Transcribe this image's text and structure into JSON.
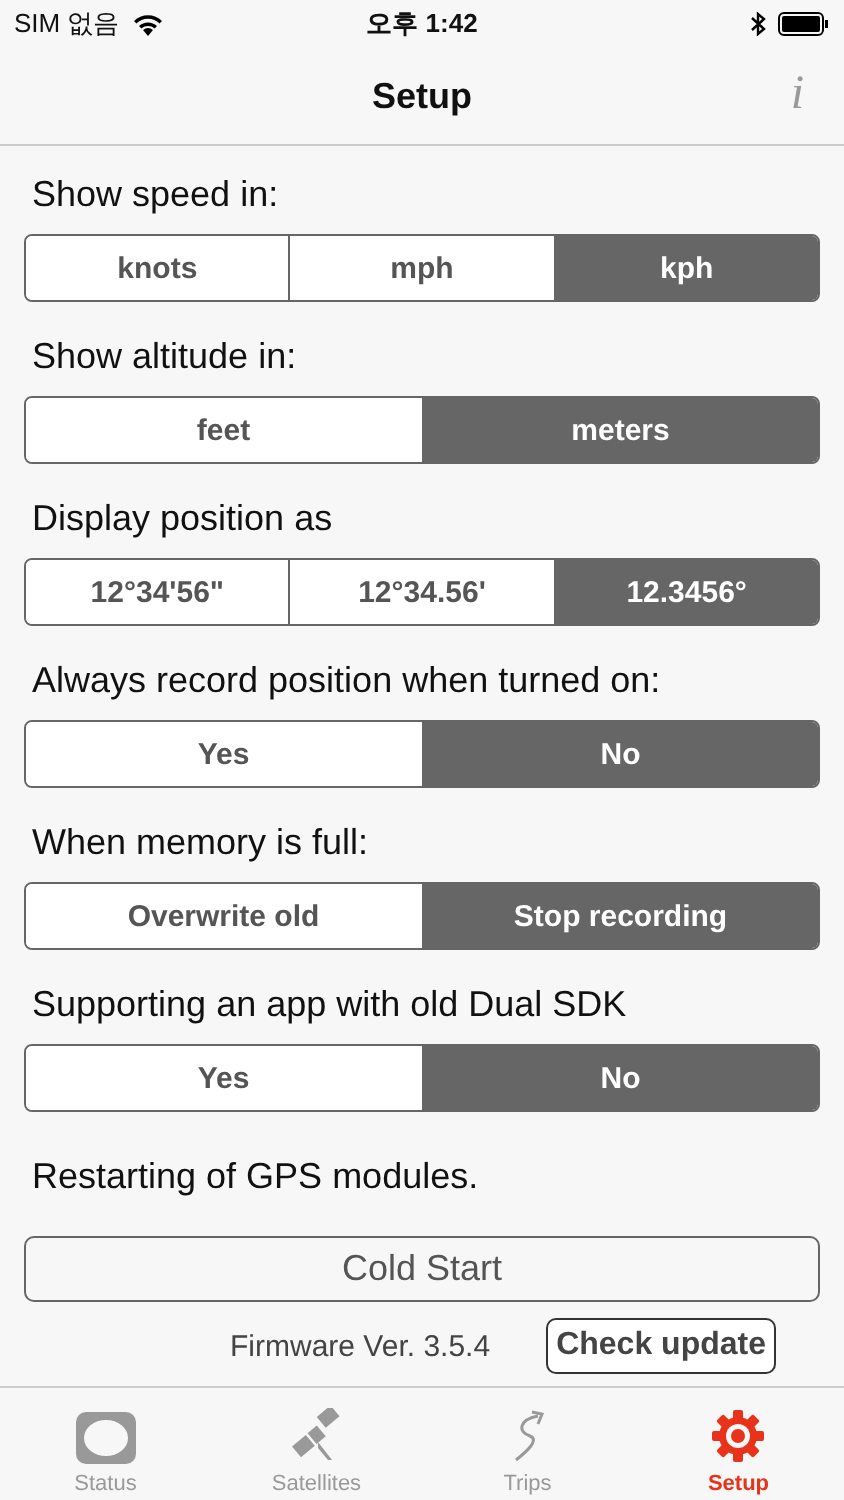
{
  "status_bar": {
    "carrier": "SIM 없음",
    "time": "오후 1:42"
  },
  "nav": {
    "title": "Setup",
    "info": "i"
  },
  "settings": [
    {
      "label": "Show speed in:",
      "options": [
        {
          "label": "knots",
          "selected": false
        },
        {
          "label": "mph",
          "selected": false
        },
        {
          "label": "kph",
          "selected": true
        }
      ]
    },
    {
      "label": "Show altitude in:",
      "options": [
        {
          "label": "feet",
          "selected": false
        },
        {
          "label": "meters",
          "selected": true
        }
      ]
    },
    {
      "label": "Display position as",
      "options": [
        {
          "label": "12°34'56\"",
          "selected": false
        },
        {
          "label": "12°34.56'",
          "selected": false
        },
        {
          "label": "12.3456°",
          "selected": true
        }
      ]
    },
    {
      "label": "Always record position when turned on:",
      "options": [
        {
          "label": "Yes",
          "selected": false
        },
        {
          "label": "No",
          "selected": true
        }
      ]
    },
    {
      "label": "When memory is full:",
      "options": [
        {
          "label": "Overwrite old",
          "selected": false
        },
        {
          "label": "Stop recording",
          "selected": true
        }
      ]
    },
    {
      "label": "Supporting an app with old Dual SDK",
      "options": [
        {
          "label": "Yes",
          "selected": false
        },
        {
          "label": "No",
          "selected": true
        }
      ]
    }
  ],
  "restart": {
    "label": "Restarting of GPS modules.",
    "button": "Cold Start"
  },
  "firmware": {
    "version": "Firmware Ver. 3.5.4",
    "button": "Check update"
  },
  "tabs": [
    {
      "kind": "status",
      "label": "Status",
      "selected": false
    },
    {
      "kind": "satellites",
      "label": "Satellites",
      "selected": false
    },
    {
      "kind": "trips",
      "label": "Trips",
      "selected": false
    },
    {
      "kind": "setup",
      "label": "Setup",
      "selected": true
    }
  ]
}
